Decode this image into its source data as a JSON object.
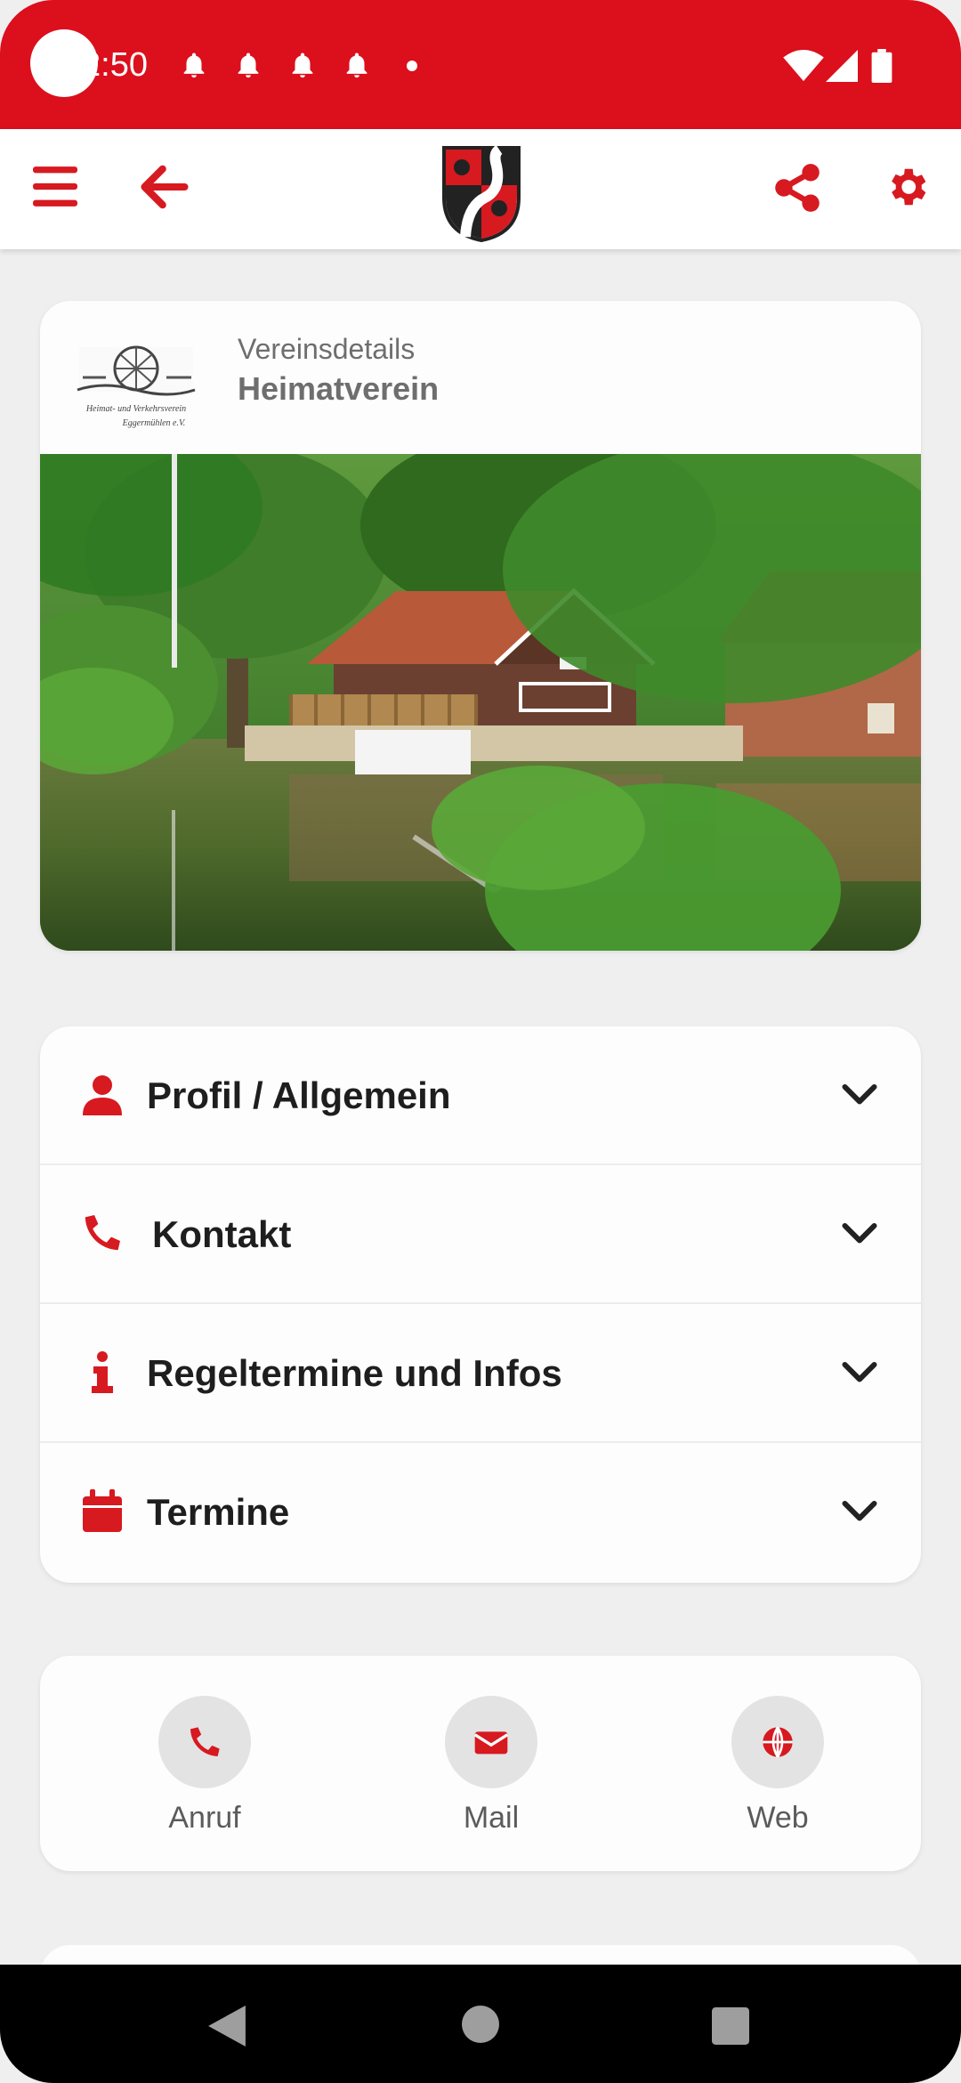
{
  "status_bar": {
    "time": "2:50",
    "color": "#dc0f1c",
    "icons": [
      "bell-icon",
      "bell-icon",
      "bell-icon",
      "bell-icon",
      "dot-icon",
      "wifi-icon",
      "signal-icon",
      "battery-icon"
    ]
  },
  "app_bar": {
    "icons": [
      "menu-icon",
      "back-arrow-icon",
      "coat-of-arms-logo",
      "share-icon",
      "settings-icon"
    ],
    "accent": "#d71920"
  },
  "club": {
    "subtitle": "Vereinsdetails",
    "name": "Heimatverein",
    "logo_icon": "club-logo",
    "photo": "mill-pond-photo"
  },
  "sections": [
    {
      "label": "Profil / Allgemein",
      "icon": "user-icon"
    },
    {
      "label": "Kontakt",
      "icon": "phone-icon"
    },
    {
      "label": "Regeltermine und Infos",
      "icon": "info-icon"
    },
    {
      "label": "Termine",
      "icon": "calendar-icon"
    }
  ],
  "actions": [
    {
      "label": "Anruf",
      "icon": "phone-icon"
    },
    {
      "label": "Mail",
      "icon": "mail-icon"
    },
    {
      "label": "Web",
      "icon": "globe-icon"
    }
  ]
}
